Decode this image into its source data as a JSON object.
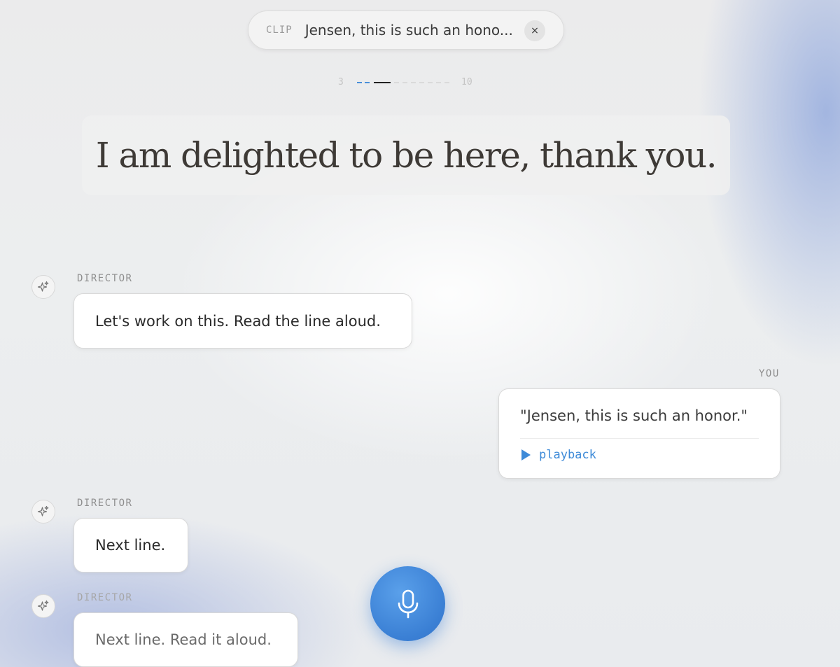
{
  "clip": {
    "tag": "CLIP",
    "text": "Jensen, this is such an hono...",
    "close_label": "×"
  },
  "progress": {
    "start_label": "3",
    "end_label": "10",
    "colors": {
      "done": "#4a90d9",
      "current": "#222222",
      "upcoming": "#dadada"
    }
  },
  "prompt": {
    "line": "I am delighted to be here, thank you."
  },
  "messages": [
    {
      "speaker": "DIRECTOR",
      "text": "Let's work on this. Read the line aloud.",
      "icon": "sparkle-icon"
    },
    {
      "speaker": "YOU",
      "text": "\"Jensen, this is such an honor.\"",
      "action": "playback",
      "icon": "play-icon"
    },
    {
      "speaker": "DIRECTOR",
      "text": "Next line.",
      "icon": "sparkle-icon"
    },
    {
      "speaker": "DIRECTOR",
      "text": "Next line. Read it aloud.",
      "icon": "sparkle-icon"
    }
  ],
  "mic": {
    "icon": "microphone-icon",
    "color": "#3a7fd4"
  }
}
